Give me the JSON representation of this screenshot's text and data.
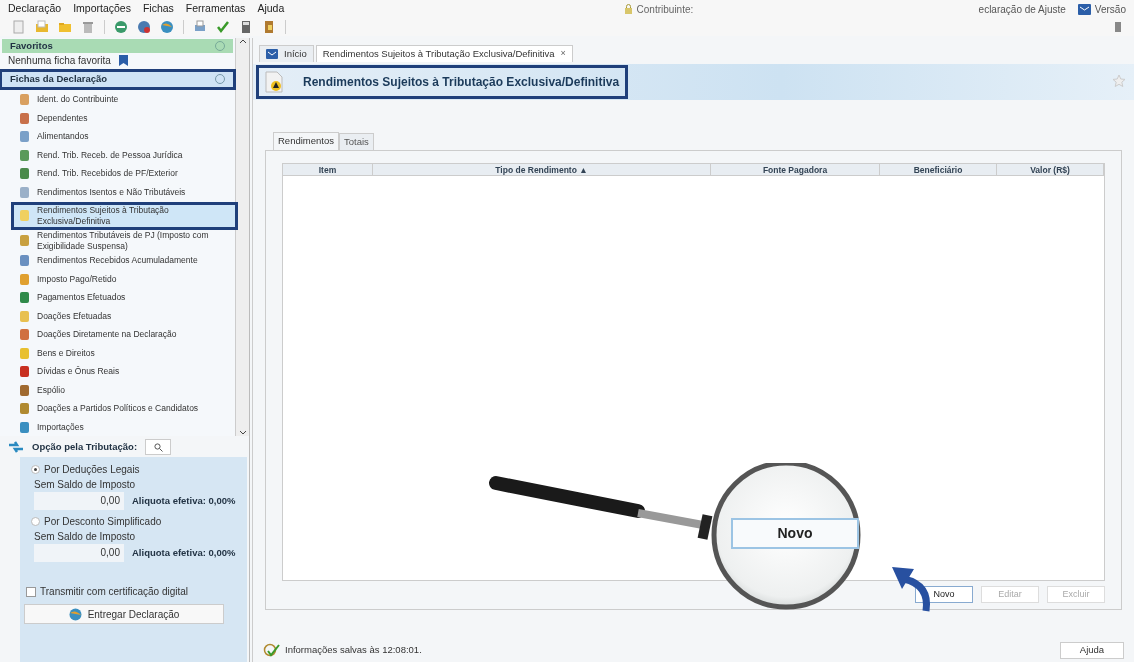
{
  "menu": [
    "Declaração",
    "Importações",
    "Fichas",
    "Ferramentas",
    "Ajuda"
  ],
  "top_info": {
    "contributor_label": "Contribuinte:",
    "declaration_text": "eclaração de Ajuste",
    "version_label": "Versão"
  },
  "sidebar": {
    "favorites": {
      "title": "Favoritos",
      "empty_text": "Nenhuma ficha favorita"
    },
    "forms": {
      "title": "Fichas da Declaração",
      "items": [
        {
          "label": "Ident. do Contribuinte",
          "selected": false
        },
        {
          "label": "Dependentes",
          "selected": false
        },
        {
          "label": "Alimentandos",
          "selected": false
        },
        {
          "label": "Rend. Trib. Receb. de Pessoa Jurídica",
          "selected": false
        },
        {
          "label": "Rend. Trib. Recebidos de PF/Exterior",
          "selected": false
        },
        {
          "label": "Rendimentos Isentos e Não Tributáveis",
          "selected": false
        },
        {
          "label": "Rendimentos Sujeitos à Tributação Exclusiva/Definitiva",
          "selected": true
        },
        {
          "label": "Rendimentos Tributáveis de PJ (Imposto com Exigibilidade Suspensa)",
          "selected": false
        },
        {
          "label": "Rendimentos Recebidos Acumuladamente",
          "selected": false
        },
        {
          "label": "Imposto Pago/Retido",
          "selected": false
        },
        {
          "label": "Pagamentos Efetuados",
          "selected": false
        },
        {
          "label": "Doações Efetuadas",
          "selected": false
        },
        {
          "label": "Doações Diretamente na Declaração",
          "selected": false
        },
        {
          "label": "Bens e Direitos",
          "selected": false
        },
        {
          "label": "Dívidas e Ônus Reais",
          "selected": false
        },
        {
          "label": "Espólio",
          "selected": false
        },
        {
          "label": "Doações a Partidos Políticos e Candidatos",
          "selected": false
        },
        {
          "label": "Importações",
          "selected": false
        }
      ]
    }
  },
  "taxation": {
    "title": "Opção pela Tributação:",
    "options": [
      {
        "label": "Por Deduções Legais",
        "selected": true,
        "balance_label": "Sem Saldo de Imposto",
        "value": "0,00",
        "rate": "Aliquota efetiva: 0,00%"
      },
      {
        "label": "Por Desconto Simplificado",
        "selected": false,
        "balance_label": "Sem Saldo de Imposto",
        "value": "0,00",
        "rate": "Aliquota efetiva: 0,00%"
      }
    ],
    "certification": {
      "label": "Transmitir com certificação digital",
      "checked": false
    },
    "submit_button": "Entregar Declaração"
  },
  "tabs": [
    {
      "label": "Início",
      "selected": false
    },
    {
      "label": "Rendimentos Sujeitos à Tributação Exclusiva/Definitiva",
      "selected": true,
      "close": "×"
    }
  ],
  "page_title": "Rendimentos Sujeitos à Tributação Exclusiva/Definitiva",
  "subtabs": [
    {
      "label": "Rendimentos",
      "selected": true
    },
    {
      "label": "Totais",
      "selected": false
    }
  ],
  "table": {
    "columns": [
      "Item",
      "Tipo de Rendimento ▲",
      "Fonte Pagadora",
      "Beneficiário",
      "Valor (R$)"
    ]
  },
  "buttons": [
    {
      "label": "Novo",
      "disabled": false
    },
    {
      "label": "Editar",
      "disabled": true
    },
    {
      "label": "Excluir",
      "disabled": true
    }
  ],
  "callout": {
    "button_label": "Novo"
  },
  "status_bar": {
    "text": "Informações salvas às 12:08:01.",
    "help_button": "Ajuda"
  }
}
